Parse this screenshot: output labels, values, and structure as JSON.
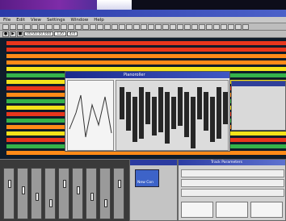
{
  "menu": {
    "items": [
      "File",
      "Edit",
      "View",
      "Settings",
      "Window",
      "Help"
    ]
  },
  "toolbar2": {
    "field1": "00:00:00:000",
    "field2": "120",
    "field3": "4/4"
  },
  "piano_roll": {
    "title": "Pianoroller"
  },
  "bottom_window": {
    "button_label": "New Con"
  },
  "info_window": {
    "title": "Track Parameters"
  },
  "colors": {
    "track_red": "#e8361c",
    "track_orange": "#ff8a18",
    "track_yellow": "#f5e21a",
    "track_green": "#34b24a",
    "title_blue": "#2a3aa8"
  }
}
